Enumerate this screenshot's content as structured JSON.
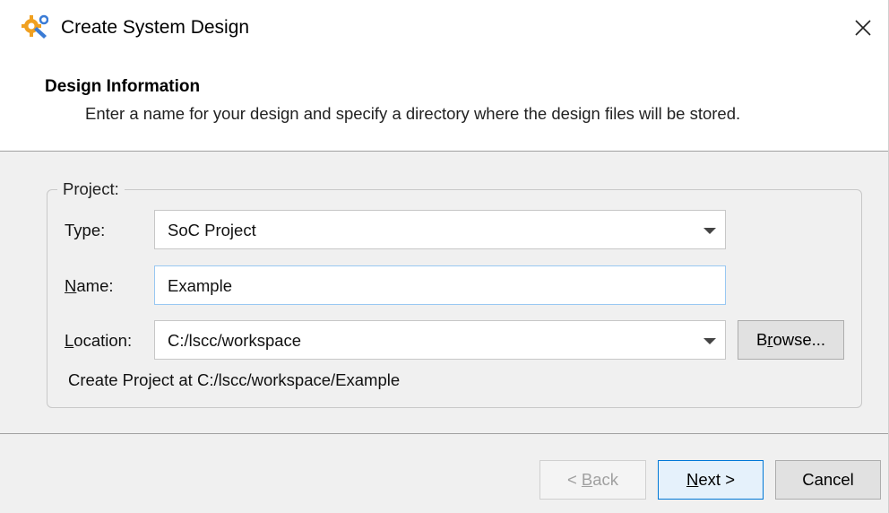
{
  "window": {
    "title": "Create System Design",
    "icon": "gear-wrench-icon"
  },
  "header": {
    "title": "Design Information",
    "description": "Enter a name for your design and specify a directory where the design files will be stored."
  },
  "project_group": {
    "label": "Project:",
    "type": {
      "label": "Type:",
      "value": "SoC Project"
    },
    "name": {
      "label_mnemonic": "N",
      "label_rest": "ame:",
      "value": "Example"
    },
    "location": {
      "label_mnemonic": "L",
      "label_rest": "ocation:",
      "value": "C:/lscc/workspace"
    },
    "browse": {
      "pre": "B",
      "mnemonic": "r",
      "post": "owse..."
    },
    "info": "Create Project at C:/lscc/workspace/Example"
  },
  "footer": {
    "back": {
      "pre": "< ",
      "mnemonic": "B",
      "post": "ack"
    },
    "next": {
      "mnemonic": "N",
      "post": "ext >"
    },
    "cancel": "Cancel"
  },
  "colors": {
    "accent": "#0078d7",
    "icon_orange": "#f0a020"
  }
}
